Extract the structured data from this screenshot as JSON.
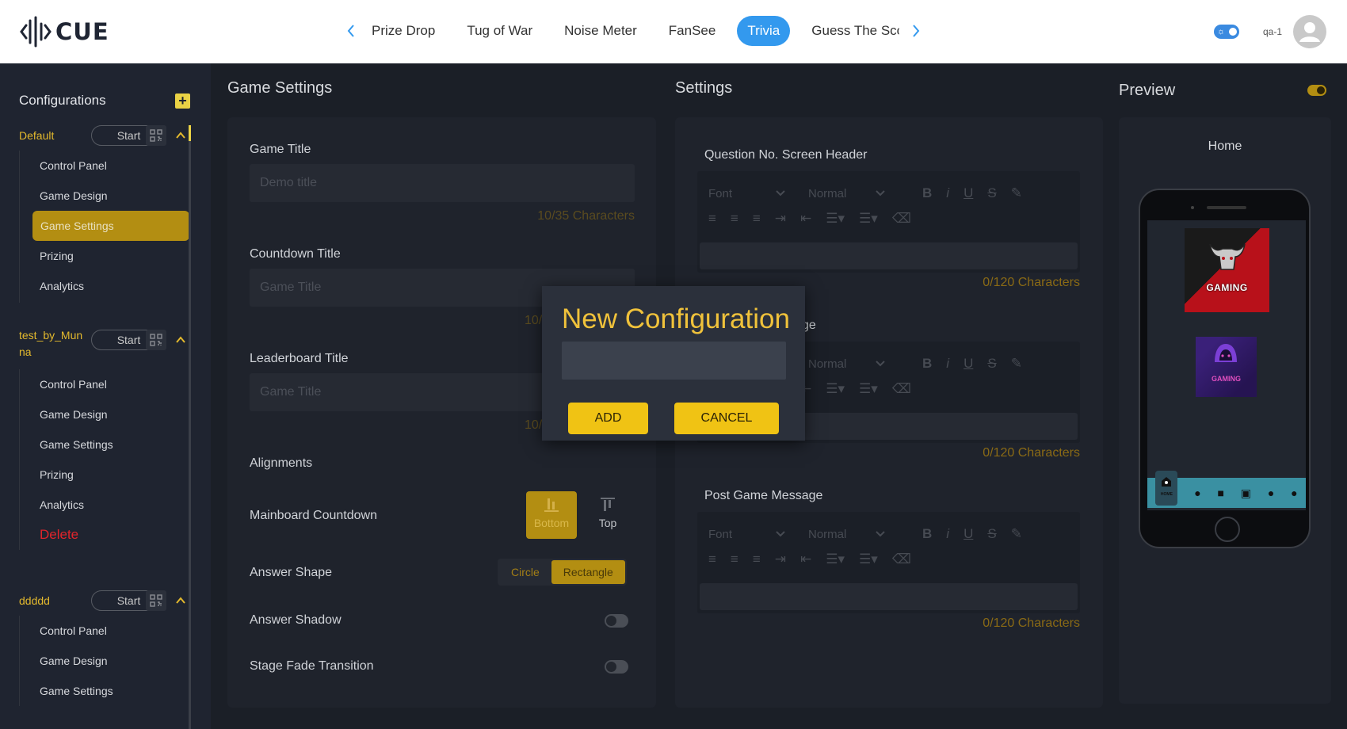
{
  "app": {
    "logo_text": "CUE"
  },
  "header": {
    "tabs": [
      {
        "label": "Prize Drop",
        "active": false
      },
      {
        "label": "Tug of War",
        "active": false
      },
      {
        "label": "Noise Meter",
        "active": false
      },
      {
        "label": "FanSee",
        "active": false
      },
      {
        "label": "Trivia",
        "active": true
      },
      {
        "label": "Guess The Sco",
        "active": false
      }
    ],
    "username": "qa-1"
  },
  "sidebar": {
    "title": "Configurations",
    "configs": [
      {
        "name": "Default",
        "start_label": "Start",
        "items": [
          "Control Panel",
          "Game Design",
          "Game Settings",
          "Prizing",
          "Analytics"
        ],
        "active_item": "Game Settings"
      },
      {
        "name_line1": "test_by_Mun",
        "name_line2": "na",
        "start_label": "Start",
        "items": [
          "Control Panel",
          "Game Design",
          "Game Settings",
          "Prizing",
          "Analytics"
        ],
        "delete_label": "Delete"
      },
      {
        "name": "ddddd",
        "start_label": "Start",
        "items": [
          "Control Panel",
          "Game Design",
          "Game Settings"
        ]
      }
    ]
  },
  "game_settings": {
    "heading": "Game Settings",
    "game_title_label": "Game Title",
    "game_title_placeholder": "Demo title",
    "game_title_count": "10/35 Characters",
    "countdown_title_label": "Countdown Title",
    "countdown_title_placeholder": "Game Title",
    "countdown_count_partial": "10/",
    "leaderboard_title_label": "Leaderboard Title",
    "leaderboard_title_placeholder": "Game Title",
    "leaderboard_count_partial": "10/",
    "alignments_label": "Alignments",
    "mainboard_countdown_label": "Mainboard Countdown",
    "align_bottom": "Bottom",
    "align_top": "Top",
    "answer_shape_label": "Answer Shape",
    "shape_circle": "Circle",
    "shape_rectangle": "Rectangle",
    "answer_shadow_label": "Answer Shadow",
    "stage_fade_label": "Stage Fade Transition"
  },
  "settings": {
    "heading": "Settings",
    "q_header_label": "Question No. Screen Header",
    "partial_label": "ge",
    "post_game_label": "Post Game Message",
    "font_label": "Font",
    "size_label": "Normal",
    "count": "0/120 Characters"
  },
  "preview": {
    "heading": "Preview",
    "screen_label": "Home",
    "logo1_text": "GAMING",
    "logo2_text": "GAMING",
    "nav_home": "HOME"
  },
  "modal": {
    "title": "New Configuration",
    "input_value": "",
    "add_label": "ADD",
    "cancel_label": "CANCEL"
  },
  "colors": {
    "accent": "#f0c314",
    "tab_active": "#3399ee",
    "delete": "#e0242b"
  }
}
